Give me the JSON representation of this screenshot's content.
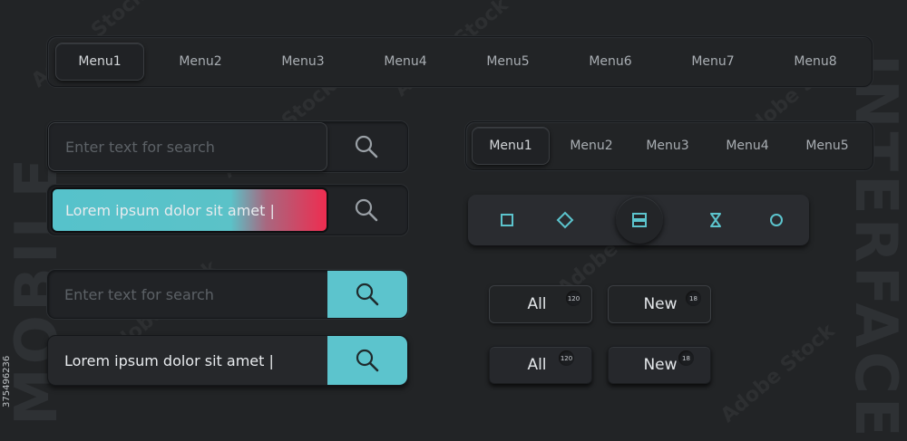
{
  "side_left_text": "MOBILE",
  "side_right_text": "INTERFACE",
  "stock_id": "375496236",
  "top_menu": {
    "items": [
      "Menu1",
      "Menu2",
      "Menu3",
      "Menu4",
      "Menu5",
      "Menu6",
      "Menu7",
      "Menu8"
    ],
    "active": "Menu1"
  },
  "small_menu": {
    "items": [
      "Menu1",
      "Menu2",
      "Menu3",
      "Menu4",
      "Menu5"
    ],
    "active": "Menu1"
  },
  "search_fields": [
    {
      "placeholder": "Enter text for search",
      "value": "",
      "style": "plain"
    },
    {
      "placeholder": "",
      "value": "Lorem ipsum dolor sit amet |",
      "style": "gradient"
    },
    {
      "placeholder": "Enter text for search",
      "value": "",
      "style": "cyan-button"
    },
    {
      "placeholder": "",
      "value": "Lorem ipsum dolor sit amet |",
      "style": "cyan-button"
    }
  ],
  "icon_bar": {
    "icons": [
      "square-icon",
      "diamond-icon",
      "menu-lines-icon",
      "hourglass-icon",
      "circle-icon"
    ],
    "active": "menu-lines-icon"
  },
  "pills": {
    "row1": [
      {
        "label": "All",
        "count": "120"
      },
      {
        "label": "New",
        "count": "18"
      }
    ],
    "row2": [
      {
        "label": "All",
        "count": "120"
      },
      {
        "label": "New",
        "count": "18"
      }
    ]
  },
  "colors": {
    "accent": "#5cc4cd",
    "gradient_end": "#ee2d50",
    "background": "#222426"
  }
}
